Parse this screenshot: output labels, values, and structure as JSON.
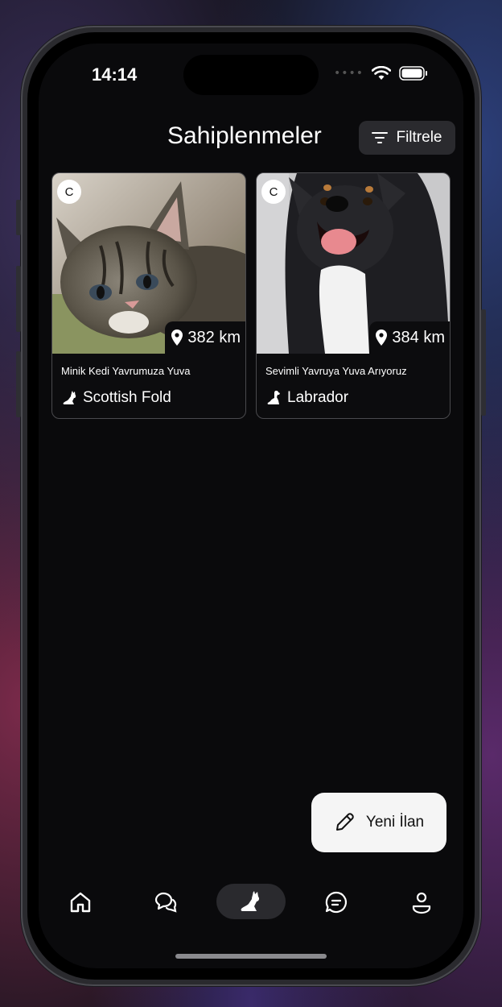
{
  "status_bar": {
    "time": "14:14"
  },
  "header": {
    "title": "Sahiplenmeler",
    "filter_label": "Filtrele"
  },
  "listings": [
    {
      "avatar_initial": "C",
      "distance": "382 km",
      "title": "Minik Kedi Yavrumuza Yuva",
      "breed": "Scottish Fold",
      "species_icon": "cat-icon"
    },
    {
      "avatar_initial": "C",
      "distance": "384 km",
      "title": "Sevimli Yavruya Yuva Arıyoruz",
      "breed": "Labrador",
      "species_icon": "dog-icon"
    }
  ],
  "fab": {
    "label": "Yeni İlan"
  },
  "tabs": [
    {
      "name": "home-icon"
    },
    {
      "name": "chat-bubbles-icon"
    },
    {
      "name": "cat-icon",
      "active": true
    },
    {
      "name": "message-icon"
    },
    {
      "name": "profile-icon"
    }
  ],
  "colors": {
    "background": "#0a0a0c",
    "card_border": "#4a4a4e",
    "chip_bg": "#2a2a2e",
    "fab_bg": "#f5f5f5"
  }
}
